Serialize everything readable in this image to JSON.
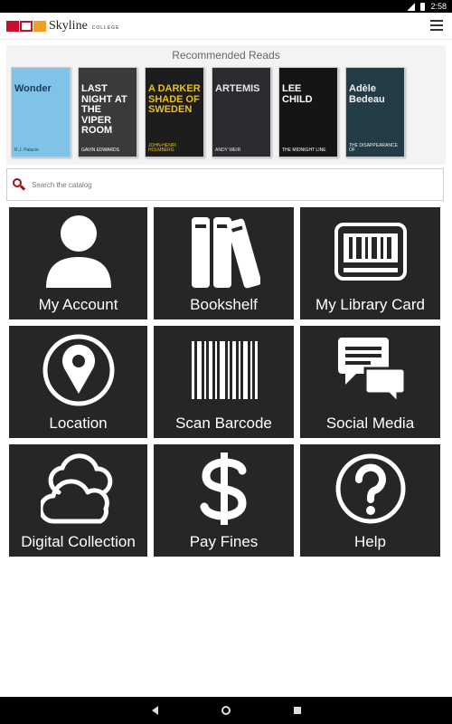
{
  "status": {
    "time": "2:58"
  },
  "app": {
    "logo_text": "Skyline",
    "logo_sub": "COLLEGE"
  },
  "recommended": {
    "title": "Recommended Reads",
    "books": [
      {
        "title": "Wonder",
        "subtitle": "R.J. Palacio",
        "bg": "#7fc4e8",
        "fg": "#1a3a5a"
      },
      {
        "title": "LAST NIGHT AT THE VIPER ROOM",
        "subtitle": "GAVIN EDWARDS",
        "bg": "#3a3a3a",
        "fg": "#ffffff"
      },
      {
        "title": "A DARKER SHADE OF SWEDEN",
        "subtitle": "JOHN-HENRI HOLMBERG",
        "bg": "#1d1d1d",
        "fg": "#e8c020"
      },
      {
        "title": "ARTEMIS",
        "subtitle": "ANDY WEIR",
        "bg": "#2c2c30",
        "fg": "#e6e6e6"
      },
      {
        "title": "LEE CHILD",
        "subtitle": "THE MIDNIGHT LINE",
        "bg": "#151515",
        "fg": "#ffffff"
      },
      {
        "title": "Adèle Bedeau",
        "subtitle": "THE DISAPPEARANCE OF",
        "bg": "#243c46",
        "fg": "#f0f0f0"
      }
    ]
  },
  "search": {
    "placeholder": "Search the catalog"
  },
  "tiles": [
    {
      "label": "My Account",
      "icon": "person-icon"
    },
    {
      "label": "Bookshelf",
      "icon": "books-icon"
    },
    {
      "label": "My Library Card",
      "icon": "library-card-icon"
    },
    {
      "label": "Location",
      "icon": "location-pin-icon"
    },
    {
      "label": "Scan Barcode",
      "icon": "barcode-icon"
    },
    {
      "label": "Social Media",
      "icon": "chat-bubbles-icon"
    },
    {
      "label": "Digital Collection",
      "icon": "cloud-icon"
    },
    {
      "label": "Pay Fines",
      "icon": "dollar-icon"
    },
    {
      "label": "Help",
      "icon": "question-icon"
    }
  ]
}
